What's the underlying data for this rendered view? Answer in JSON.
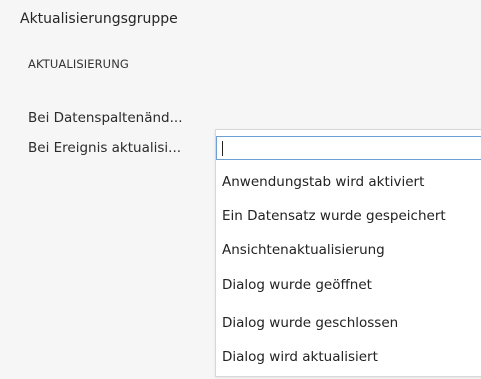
{
  "panel": {
    "group_title": "Aktualisierungsgruppe",
    "section_title": "AKTUALISIERUNG",
    "fields": [
      {
        "label": "Bei Datenspaltenänd..."
      },
      {
        "label": "Bei Ereignis aktualisi..."
      }
    ]
  },
  "dropdown": {
    "value": "",
    "options": [
      "Anwendungstab wird aktiviert",
      "Ein Datensatz wurde gespeichert",
      "Ansichtenaktualisierung",
      "Dialog wurde geöffnet",
      "Dialog wurde geschlossen",
      "Dialog wird aktualisiert"
    ]
  }
}
